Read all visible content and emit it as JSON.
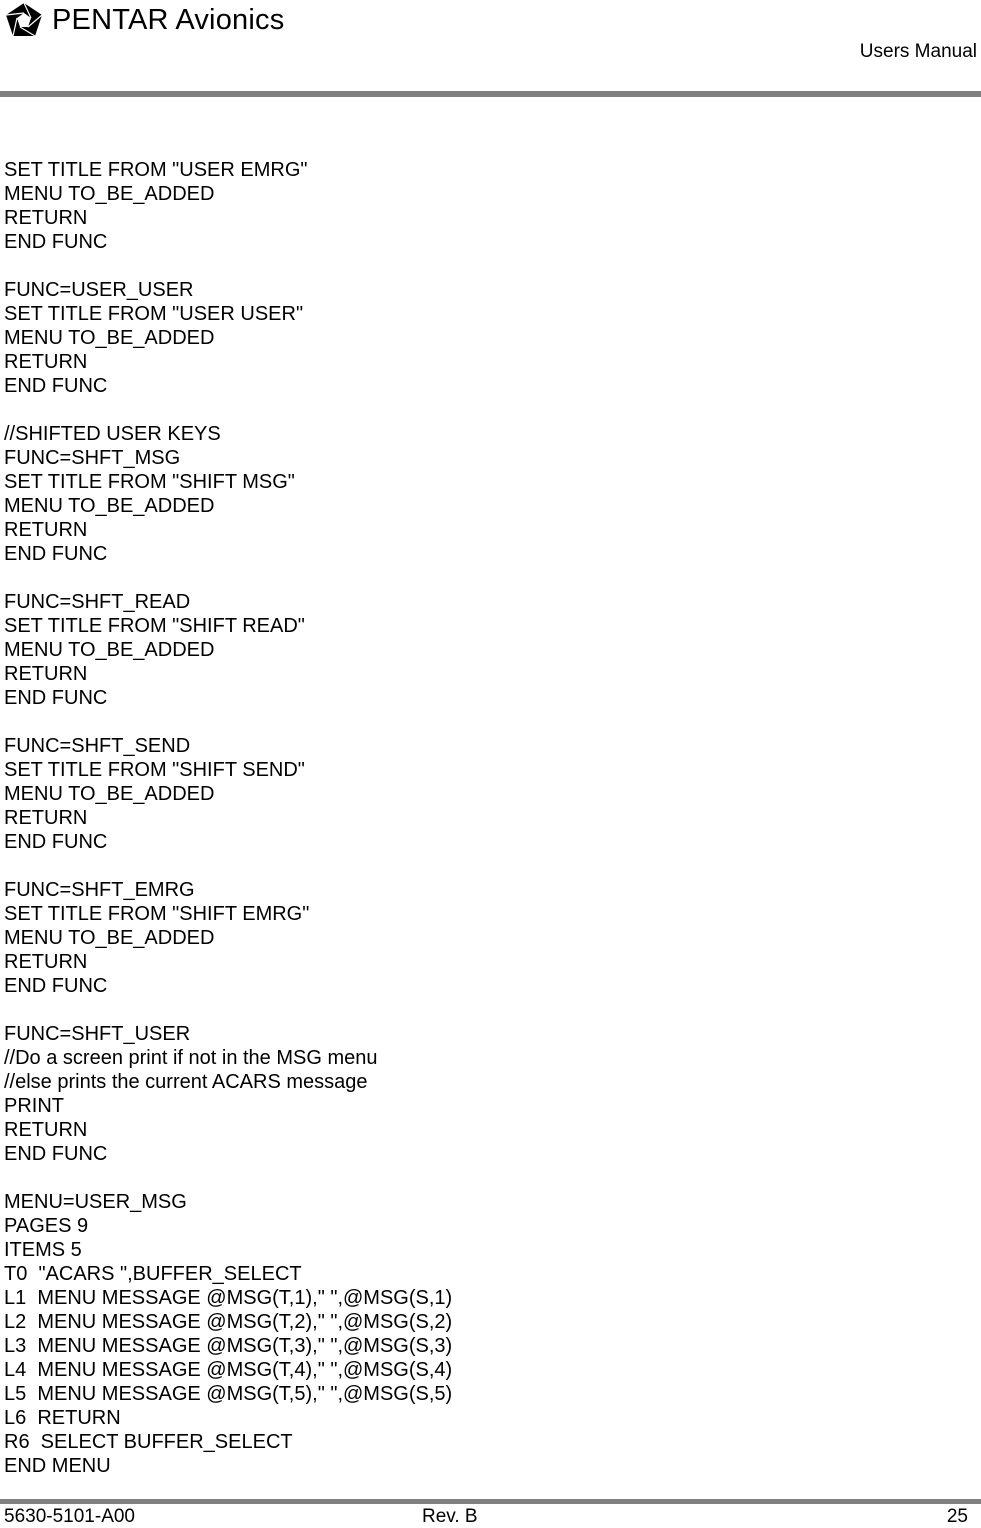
{
  "header": {
    "logo_icon": "pentagon-aperture-logo",
    "brand": "PENTAR Avionics",
    "doc_type": "Users Manual"
  },
  "body": {
    "lines": [
      "SET TITLE FROM \"USER EMRG\"",
      "MENU TO_BE_ADDED",
      "RETURN",
      "END FUNC",
      "",
      "FUNC=USER_USER",
      "SET TITLE FROM \"USER USER\"",
      "MENU TO_BE_ADDED",
      "RETURN",
      "END FUNC",
      "",
      "//SHIFTED USER KEYS",
      "FUNC=SHFT_MSG",
      "SET TITLE FROM \"SHIFT MSG\"",
      "MENU TO_BE_ADDED",
      "RETURN",
      "END FUNC",
      "",
      "FUNC=SHFT_READ",
      "SET TITLE FROM \"SHIFT READ\"",
      "MENU TO_BE_ADDED",
      "RETURN",
      "END FUNC",
      "",
      "FUNC=SHFT_SEND",
      "SET TITLE FROM \"SHIFT SEND\"",
      "MENU TO_BE_ADDED",
      "RETURN",
      "END FUNC",
      "",
      "FUNC=SHFT_EMRG",
      "SET TITLE FROM \"SHIFT EMRG\"",
      "MENU TO_BE_ADDED",
      "RETURN",
      "END FUNC",
      "",
      "FUNC=SHFT_USER",
      "//Do a screen print if not in the MSG menu",
      "//else prints the current ACARS message",
      "PRINT",
      "RETURN",
      "END FUNC",
      "",
      "MENU=USER_MSG",
      "PAGES 9",
      "ITEMS 5",
      "T0  \"ACARS \",BUFFER_SELECT",
      "L1  MENU MESSAGE @MSG(T,1),\" \",@MSG(S,1)",
      "L2  MENU MESSAGE @MSG(T,2),\" \",@MSG(S,2)",
      "L3  MENU MESSAGE @MSG(T,3),\" \",@MSG(S,3)",
      "L4  MENU MESSAGE @MSG(T,4),\" \",@MSG(S,4)",
      "L5  MENU MESSAGE @MSG(T,5),\" \",@MSG(S,5)",
      "L6  RETURN",
      "R6  SELECT BUFFER_SELECT",
      "END MENU"
    ]
  },
  "footer": {
    "doc_number": "5630-5101-A00",
    "revision": "Rev. B",
    "page_number": "25"
  }
}
